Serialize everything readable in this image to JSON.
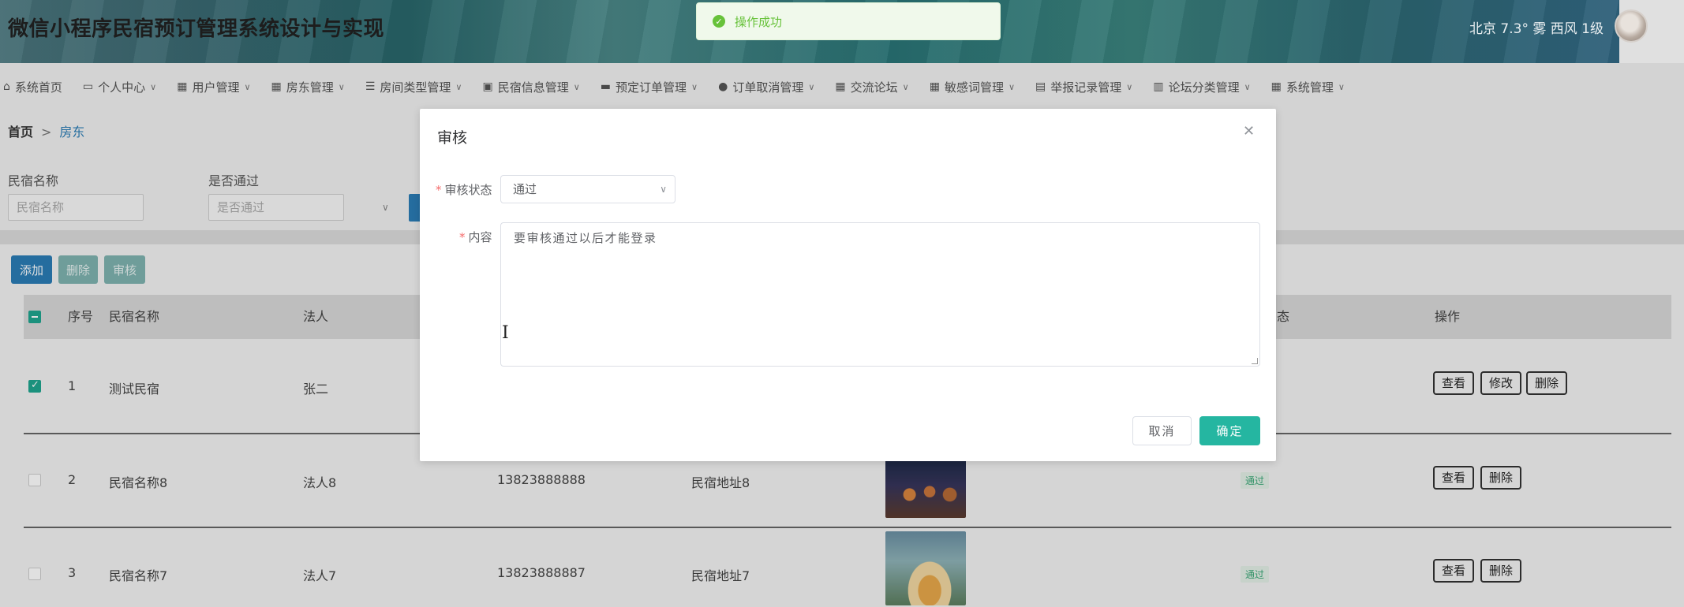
{
  "header": {
    "title": "微信小程序民宿预订管理系统设计与实现",
    "weather": "北京  7.3°  雾  西风  1级"
  },
  "nav": [
    {
      "icon": "⌂",
      "label": "系统首页",
      "caret": false
    },
    {
      "icon": "▭",
      "label": "个人中心",
      "caret": true
    },
    {
      "icon": "▦",
      "label": "用户管理",
      "caret": true
    },
    {
      "icon": "▦",
      "label": "房东管理",
      "caret": true
    },
    {
      "icon": "☰",
      "label": "房间类型管理",
      "caret": true
    },
    {
      "icon": "▣",
      "label": "民宿信息管理",
      "caret": true
    },
    {
      "icon": "▬",
      "label": "预定订单管理",
      "caret": true
    },
    {
      "icon": "●",
      "label": "订单取消管理",
      "caret": true
    },
    {
      "icon": "▦",
      "label": "交流论坛",
      "caret": true
    },
    {
      "icon": "▦",
      "label": "敏感词管理",
      "caret": true
    },
    {
      "icon": "▤",
      "label": "举报记录管理",
      "caret": true
    },
    {
      "icon": "▥",
      "label": "论坛分类管理",
      "caret": true
    },
    {
      "icon": "▦",
      "label": "系统管理",
      "caret": true
    }
  ],
  "breadcrumb": {
    "home": "首页",
    "sep": ">",
    "current": "房东"
  },
  "search": {
    "name_label": "民宿名称",
    "name_placeholder": "民宿名称",
    "pass_label": "是否通过",
    "pass_placeholder": "是否通过"
  },
  "toolbar": {
    "add": "添加",
    "delete": "删除",
    "audit": "审核"
  },
  "table": {
    "headers": {
      "index": "序号",
      "name": "民宿名称",
      "legal": "法人",
      "status": "态",
      "actions": "操作"
    },
    "rows": [
      {
        "index": "1",
        "name": "测试民宿",
        "legal": "张二",
        "phone": "",
        "address": "",
        "status": "",
        "checked": true,
        "actions": [
          "查看",
          "修改",
          "删除"
        ]
      },
      {
        "index": "2",
        "name": "民宿名称8",
        "legal": "法人8",
        "phone": "13823888888",
        "address": "民宿地址8",
        "status": "通过",
        "checked": false,
        "actions": [
          "查看",
          "删除"
        ]
      },
      {
        "index": "3",
        "name": "民宿名称7",
        "legal": "法人7",
        "phone": "13823888887",
        "address": "民宿地址7",
        "status": "通过",
        "checked": false,
        "actions": [
          "查看",
          "删除"
        ]
      }
    ]
  },
  "toast": {
    "message": "操作成功"
  },
  "dialog": {
    "title": "审核",
    "status_label": "审核状态",
    "status_value": "通过",
    "content_label": "内容",
    "content_value": "要审核通过以后才能登录",
    "cancel": "取消",
    "confirm": "确定"
  },
  "colors": {
    "accent": "#25b6a1",
    "primary": "#2b7db6",
    "success": "#67c23a"
  }
}
